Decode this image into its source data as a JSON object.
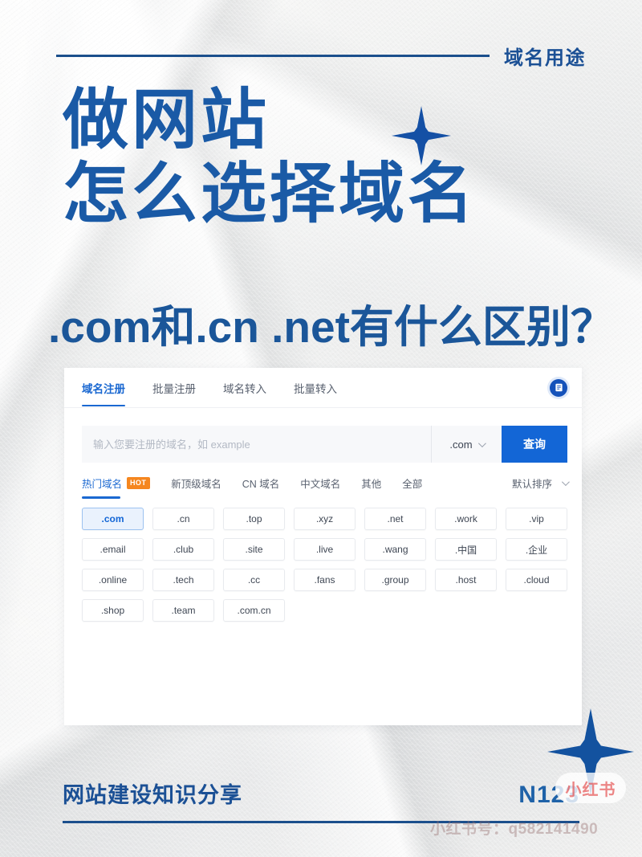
{
  "poster": {
    "kicker": "域名用途",
    "headline_line1": "做网站",
    "headline_line2": "怎么选择域名",
    "subhead": ".com和.cn .net有什么区别？",
    "accent_blue": "#1a5aa6",
    "rule_blue": "#1b4f8c",
    "background": "crumpled-paper-light-gray"
  },
  "panel": {
    "tabs": [
      {
        "label": "域名注册",
        "active": true
      },
      {
        "label": "批量注册",
        "active": false
      },
      {
        "label": "域名转入",
        "active": false
      },
      {
        "label": "批量转入",
        "active": false
      }
    ],
    "badge_icon": "document-list-icon",
    "search": {
      "placeholder": "输入您要注册的域名，如 example",
      "value": "",
      "tld_selected": ".com",
      "button_label": "查询",
      "button_color": "#1366d6"
    },
    "filters": [
      {
        "label": "热门域名",
        "badge": "HOT",
        "active": true
      },
      {
        "label": "新顶级域名",
        "badge": "",
        "active": false
      },
      {
        "label": "CN 域名",
        "badge": "",
        "active": false
      },
      {
        "label": "中文域名",
        "badge": "",
        "active": false
      },
      {
        "label": "其他",
        "badge": "",
        "active": false
      },
      {
        "label": "全部",
        "badge": "",
        "active": false
      }
    ],
    "sort_label": "默认排序",
    "hot_badge_color": "#f5861f",
    "tlds": [
      {
        "label": ".com",
        "selected": true
      },
      {
        "label": ".cn",
        "selected": false
      },
      {
        "label": ".top",
        "selected": false
      },
      {
        "label": ".xyz",
        "selected": false
      },
      {
        "label": ".net",
        "selected": false
      },
      {
        "label": ".work",
        "selected": false
      },
      {
        "label": ".vip",
        "selected": false
      },
      {
        "label": ".email",
        "selected": false
      },
      {
        "label": ".club",
        "selected": false
      },
      {
        "label": ".site",
        "selected": false
      },
      {
        "label": ".live",
        "selected": false
      },
      {
        "label": ".wang",
        "selected": false
      },
      {
        "label": ".中国",
        "selected": false
      },
      {
        "label": ".企业",
        "selected": false
      },
      {
        "label": ".online",
        "selected": false
      },
      {
        "label": ".tech",
        "selected": false
      },
      {
        "label": ".cc",
        "selected": false
      },
      {
        "label": ".fans",
        "selected": false
      },
      {
        "label": ".group",
        "selected": false
      },
      {
        "label": ".host",
        "selected": false
      },
      {
        "label": ".cloud",
        "selected": false
      },
      {
        "label": ".shop",
        "selected": false
      },
      {
        "label": ".team",
        "selected": false
      },
      {
        "label": ".com.cn",
        "selected": false
      }
    ]
  },
  "footer": {
    "left": "网站建设知识分享",
    "right": "N123"
  },
  "watermark": {
    "logo": "小红书",
    "id": "小红书号：q582141490"
  }
}
